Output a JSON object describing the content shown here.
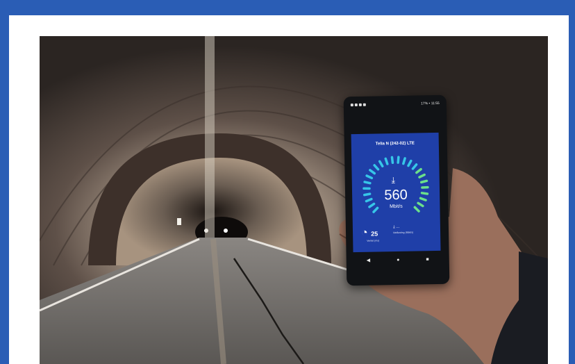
{
  "phone": {
    "operator": "Telia N (242-02) LTE",
    "status_right": "17% ▪ 11:55",
    "speed_value": "560",
    "speed_unit": "Mbit/s",
    "ping_value": "25",
    "ping_label": "Ventet (ms)",
    "download_placeholder": "...",
    "download_label": "Nedlasting (Mbit/s)",
    "nav": [
      "◀",
      "●",
      "■"
    ]
  },
  "colors": {
    "border": "#2a5db5",
    "screen": "#1f3fa8",
    "gauge_cyan": "#36c6e8",
    "gauge_green": "#6be08a"
  },
  "icons": [
    "download-arrow-icon",
    "ping-icon",
    "back-nav-icon",
    "home-nav-icon",
    "recents-nav-icon"
  ]
}
